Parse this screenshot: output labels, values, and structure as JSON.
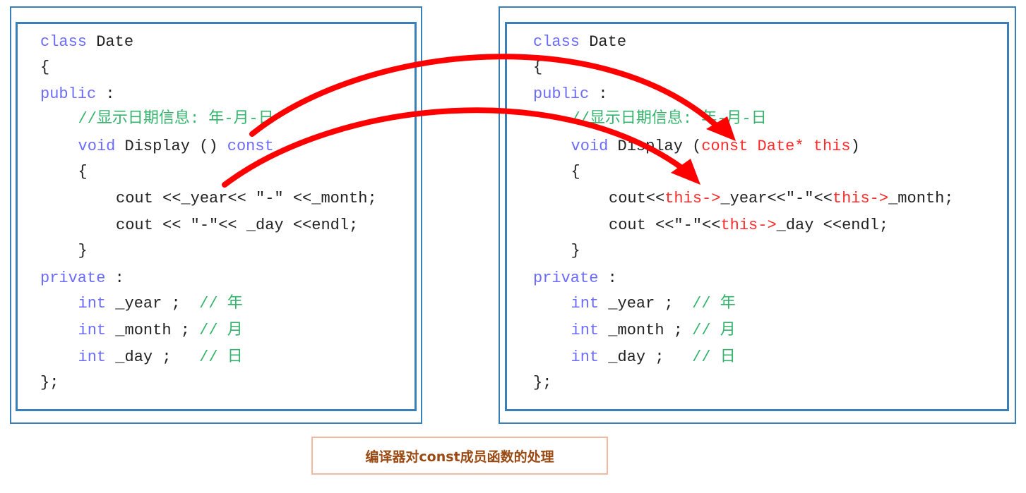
{
  "colors": {
    "box_border": "#3b7fb8",
    "keyword": "#6b6bff",
    "comment": "#33b36b",
    "highlight": "#ff2a2a",
    "arrow": "#ff0000",
    "caption_text": "#9a4a12",
    "caption_border": "#f4b8a0"
  },
  "left_code": [
    {
      "indent": 0,
      "tokens": [
        [
          "class",
          "kw"
        ],
        [
          " Date",
          ""
        ]
      ]
    },
    {
      "indent": 0,
      "tokens": [
        [
          "{",
          ""
        ]
      ]
    },
    {
      "indent": 0,
      "tokens": [
        [
          "public",
          "kw"
        ],
        [
          " :",
          ""
        ]
      ]
    },
    {
      "indent": 1,
      "tokens": [
        [
          "//显示日期信息: 年-月-日",
          "cm"
        ]
      ]
    },
    {
      "indent": 1,
      "tokens": [
        [
          "void",
          "kw"
        ],
        [
          " Display () ",
          ""
        ],
        [
          "const",
          "kw"
        ]
      ]
    },
    {
      "indent": 1,
      "tokens": [
        [
          "{",
          ""
        ]
      ]
    },
    {
      "indent": 2,
      "tokens": [
        [
          "cout <<_year<< \"-\" <<_month;",
          ""
        ]
      ]
    },
    {
      "indent": 2,
      "tokens": [
        [
          "cout << \"-\"<< _day <<endl;",
          ""
        ]
      ]
    },
    {
      "indent": 1,
      "tokens": [
        [
          "}",
          ""
        ]
      ]
    },
    {
      "indent": 0,
      "tokens": [
        [
          "private",
          "kw"
        ],
        [
          " :",
          ""
        ]
      ]
    },
    {
      "indent": 1,
      "tokens": [
        [
          "int",
          "kw"
        ],
        [
          " _year ;  ",
          ""
        ],
        [
          "// 年",
          "cm"
        ]
      ]
    },
    {
      "indent": 1,
      "tokens": [
        [
          "int",
          "kw"
        ],
        [
          " _month ; ",
          ""
        ],
        [
          "// 月",
          "cm"
        ]
      ]
    },
    {
      "indent": 1,
      "tokens": [
        [
          "int",
          "kw"
        ],
        [
          " _day ;   ",
          ""
        ],
        [
          "// 日",
          "cm"
        ]
      ]
    },
    {
      "indent": 0,
      "tokens": [
        [
          "};",
          ""
        ]
      ]
    }
  ],
  "right_code": [
    {
      "indent": 0,
      "tokens": [
        [
          "class",
          "kw"
        ],
        [
          " Date",
          ""
        ]
      ]
    },
    {
      "indent": 0,
      "tokens": [
        [
          "{",
          ""
        ]
      ]
    },
    {
      "indent": 0,
      "tokens": [
        [
          "public",
          "kw"
        ],
        [
          " :",
          ""
        ]
      ]
    },
    {
      "indent": 1,
      "tokens": [
        [
          "//显示日期信息: 年-月-日",
          "cm"
        ]
      ]
    },
    {
      "indent": 1,
      "tokens": [
        [
          "void",
          "kw"
        ],
        [
          " Display (",
          ""
        ],
        [
          "const Date* this",
          "red"
        ],
        [
          ")",
          ""
        ]
      ]
    },
    {
      "indent": 1,
      "tokens": [
        [
          "{",
          ""
        ]
      ]
    },
    {
      "indent": 2,
      "tokens": [
        [
          "cout<<",
          ""
        ],
        [
          "this->",
          "red"
        ],
        [
          "_year<<\"-\"<<",
          ""
        ],
        [
          "this->",
          "red"
        ],
        [
          "_month;",
          ""
        ]
      ]
    },
    {
      "indent": 2,
      "tokens": [
        [
          "cout <<\"-\"<<",
          ""
        ],
        [
          "this->",
          "red"
        ],
        [
          "_day <<endl;",
          ""
        ]
      ]
    },
    {
      "indent": 1,
      "tokens": [
        [
          "}",
          ""
        ]
      ]
    },
    {
      "indent": 0,
      "tokens": [
        [
          "private",
          "kw"
        ],
        [
          " :",
          ""
        ]
      ]
    },
    {
      "indent": 1,
      "tokens": [
        [
          "int",
          "kw"
        ],
        [
          " _year ;  ",
          ""
        ],
        [
          "// 年",
          "cm"
        ]
      ]
    },
    {
      "indent": 1,
      "tokens": [
        [
          "int",
          "kw"
        ],
        [
          " _month ; ",
          ""
        ],
        [
          "// 月",
          "cm"
        ]
      ]
    },
    {
      "indent": 1,
      "tokens": [
        [
          "int",
          "kw"
        ],
        [
          " _day ;   ",
          ""
        ],
        [
          "// 日",
          "cm"
        ]
      ]
    },
    {
      "indent": 0,
      "tokens": [
        [
          "};",
          ""
        ]
      ]
    }
  ],
  "caption": "编译器对const成员函数的处理"
}
